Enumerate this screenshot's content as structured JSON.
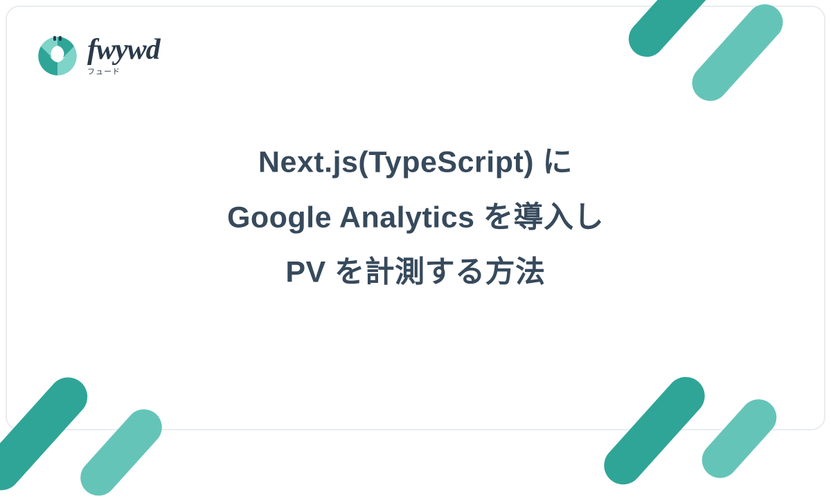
{
  "logo": {
    "name": "fwywd",
    "subtitle": "フュード"
  },
  "title": {
    "line1": "Next.js(TypeScript) に",
    "line2": "Google Analytics を導入し",
    "line3": "PV を計測する方法"
  },
  "colors": {
    "teal_dark": "#2fa597",
    "teal_light": "#65c4b8",
    "text": "#374a5c"
  }
}
